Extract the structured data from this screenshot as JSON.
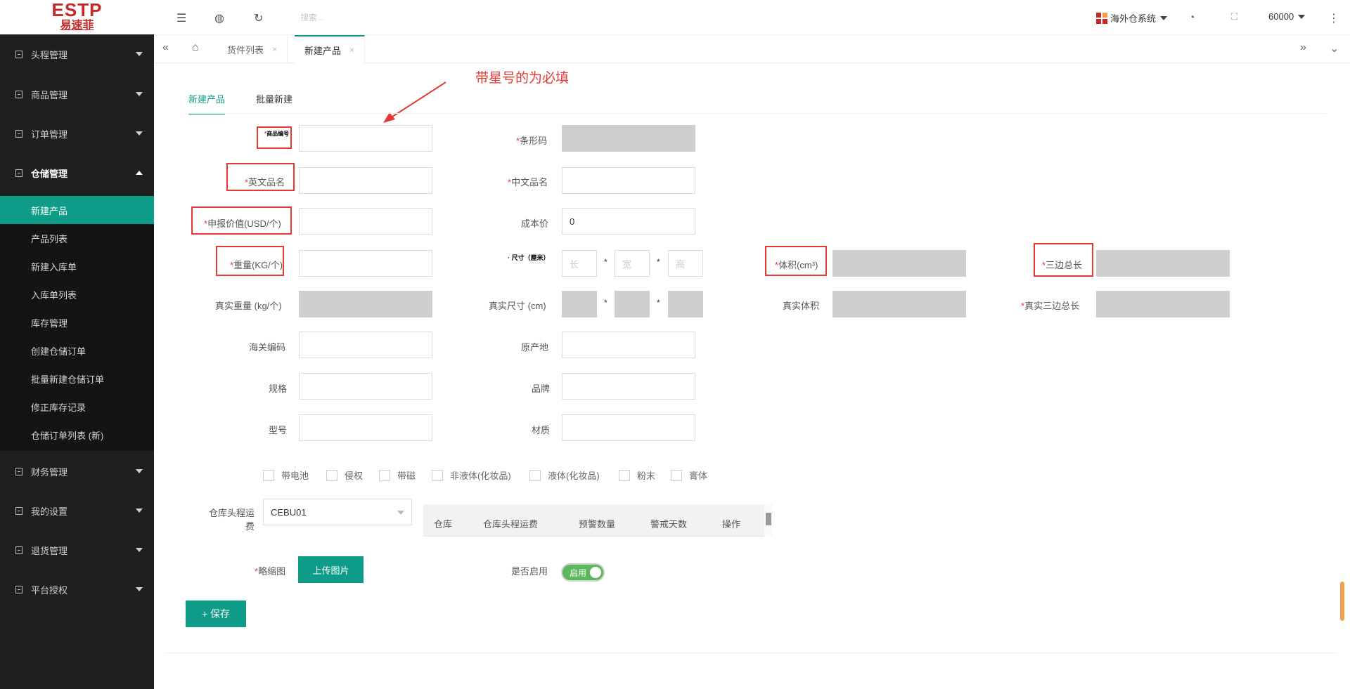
{
  "logo": {
    "en": "ESTP",
    "cn": "易速菲"
  },
  "sidebar": {
    "top_items": [
      {
        "label": "头程管理"
      },
      {
        "label": "商品管理"
      },
      {
        "label": "订单管理"
      },
      {
        "label": "仓储管理"
      }
    ],
    "submenu": [
      {
        "label": "新建产品"
      },
      {
        "label": "产品列表"
      },
      {
        "label": "新建入库单"
      },
      {
        "label": "入库单列表"
      },
      {
        "label": "库存管理"
      },
      {
        "label": "创建仓储订单"
      },
      {
        "label": "批量新建仓储订单"
      },
      {
        "label": "修正库存记录"
      },
      {
        "label": "仓储订单列表 (新)"
      }
    ],
    "bottom_items": [
      {
        "label": "财务管理"
      },
      {
        "label": "我的设置"
      },
      {
        "label": "退货管理"
      },
      {
        "label": "平台授权"
      }
    ]
  },
  "header": {
    "search_placeholder": "搜索...",
    "system_label": "海外仓系统",
    "user_label": "60000",
    "icons": [
      "menu-fold-icon",
      "globe-icon",
      "refresh-icon",
      "palette-icon",
      "fullscreen-icon",
      "more-icon"
    ]
  },
  "tabs": [
    {
      "label": "货件列表"
    },
    {
      "label": "新建产品"
    }
  ],
  "annotation": "带星号的为必填",
  "content_tabs": {
    "active": "新建产品",
    "other": "批量新建"
  },
  "form": {
    "sku_label": "商品编号",
    "barcode_label": "条形码",
    "en_name_label": "英文品名",
    "cn_name_label": "中文品名",
    "declared_label": "申报价值(USD/个)",
    "cost_label": "成本价",
    "cost_value": "0",
    "weight_label": "重量(KG/个)",
    "size_label": "尺寸（厘米）",
    "size_l": "长",
    "size_w": "宽",
    "size_h": "高",
    "volume_label": "体积(cm³)",
    "three_sides_label": "三边总长",
    "real_weight_label": "真实重量 (kg/个)",
    "real_size_label": "真实尺寸 (cm)",
    "real_volume_label": "真实体积",
    "real_three_sides_label": "真实三边总长",
    "hs_label": "海关编码",
    "origin_label": "原产地",
    "spec_label": "规格",
    "brand_label": "品牌",
    "model_label": "型号",
    "material_label": "材质",
    "checkboxes": [
      "带电池",
      "侵权",
      "带磁",
      "非液体(化妆品)",
      "液体(化妆品)",
      "粉末",
      "膏体"
    ],
    "warehouse_fee_label_1": "仓库头程运",
    "warehouse_fee_label_2": "费",
    "warehouse_select": "CEBU01",
    "table_headers": [
      "仓库",
      "仓库头程运费",
      "预警数量",
      "警戒天数",
      "操作"
    ],
    "thumb_label": "略缩图",
    "upload_label": "上传图片",
    "enable_label": "是否启用",
    "switch_label": "启用",
    "save_label": "+ 保存"
  },
  "colors": {
    "accent": "#0e9b87",
    "sidebar": "#1f1f1f",
    "required": "#e53935"
  }
}
